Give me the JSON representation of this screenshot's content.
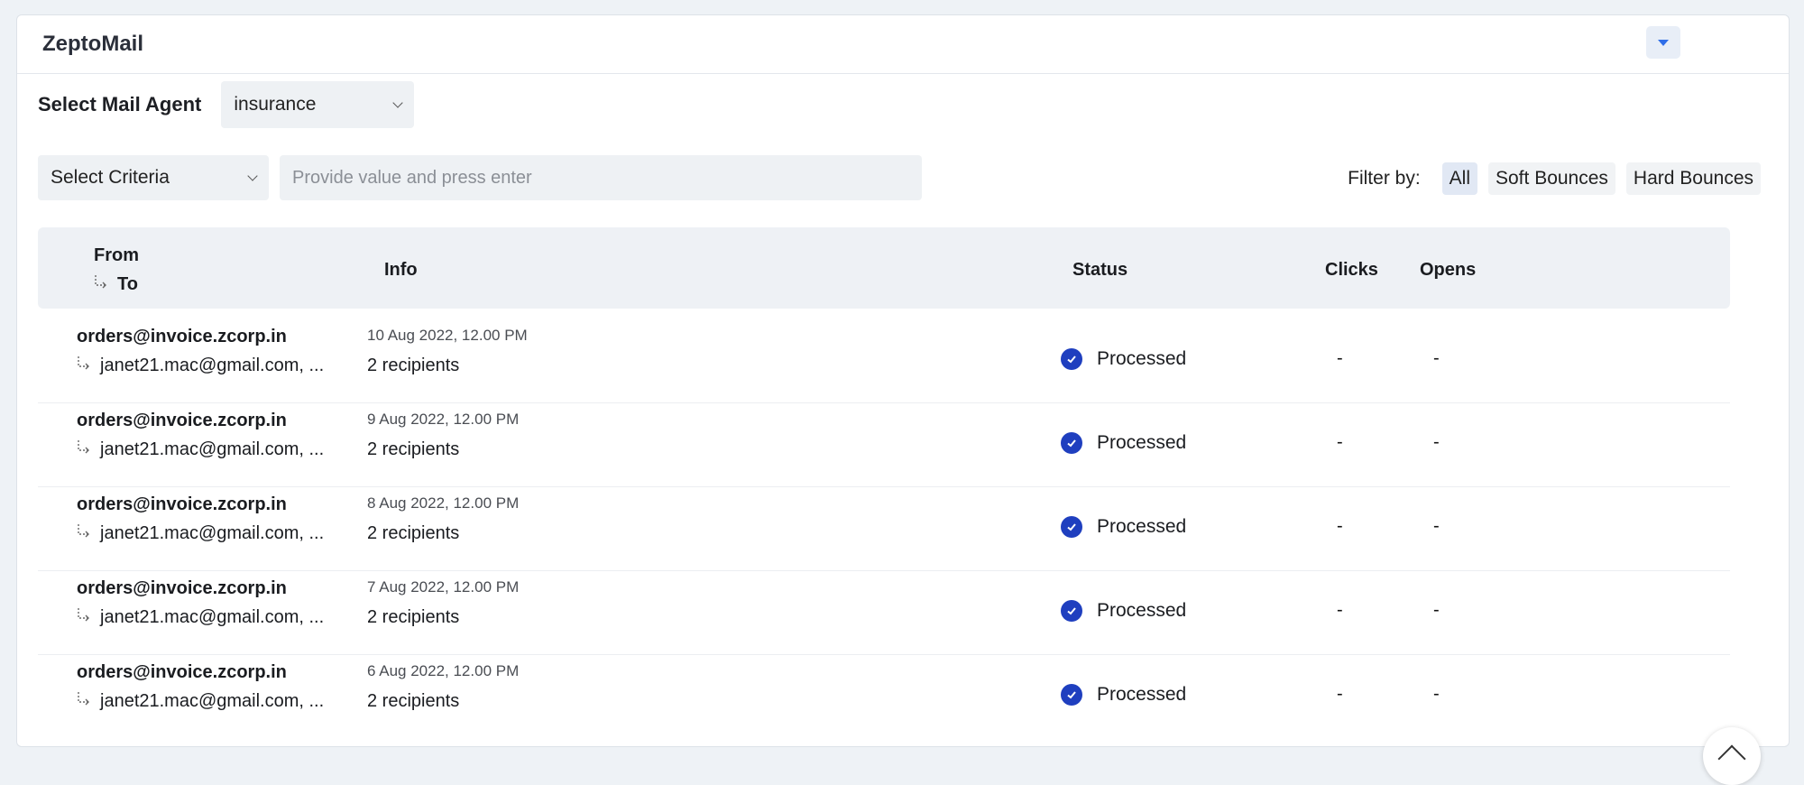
{
  "app": {
    "title": "ZeptoMail"
  },
  "agent": {
    "label": "Select Mail Agent",
    "value": "insurance"
  },
  "search": {
    "criteria": "Select Criteria",
    "placeholder": "Provide value and press enter"
  },
  "filter": {
    "label": "Filter by:",
    "options": [
      "All",
      "Soft Bounces",
      "Hard Bounces"
    ],
    "selected": "All"
  },
  "columns": {
    "from": "From",
    "to": "To",
    "info": "Info",
    "status": "Status",
    "clicks": "Clicks",
    "opens": "Opens"
  },
  "rows": [
    {
      "from": "orders@invoice.zcorp.in",
      "to": "janet21.mac@gmail.com, ...",
      "date": "10 Aug 2022, 12.00 PM",
      "recipients": "2 recipients",
      "status": "Processed",
      "clicks": "-",
      "opens": "-"
    },
    {
      "from": "orders@invoice.zcorp.in",
      "to": "janet21.mac@gmail.com, ...",
      "date": "9 Aug 2022, 12.00 PM",
      "recipients": "2 recipients",
      "status": "Processed",
      "clicks": "-",
      "opens": "-"
    },
    {
      "from": "orders@invoice.zcorp.in",
      "to": "janet21.mac@gmail.com, ...",
      "date": "8 Aug 2022, 12.00 PM",
      "recipients": "2 recipients",
      "status": "Processed",
      "clicks": "-",
      "opens": "-"
    },
    {
      "from": "orders@invoice.zcorp.in",
      "to": "janet21.mac@gmail.com, ...",
      "date": "7 Aug 2022, 12.00 PM",
      "recipients": "2 recipients",
      "status": "Processed",
      "clicks": "-",
      "opens": "-"
    },
    {
      "from": "orders@invoice.zcorp.in",
      "to": "janet21.mac@gmail.com, ...",
      "date": "6 Aug 2022, 12.00 PM",
      "recipients": "2 recipients",
      "status": "Processed",
      "clicks": "-",
      "opens": "-"
    }
  ],
  "icons": {
    "status_processed": "check-circle-icon",
    "recipient_arrow": "reply-arrow-icon",
    "scroll_top": "chevron-up-icon",
    "header_menu": "caret-down-icon"
  },
  "colors": {
    "accent": "#2f6ee8",
    "status_processed": "#1f3fbf",
    "page_bg": "#eef2f6"
  }
}
